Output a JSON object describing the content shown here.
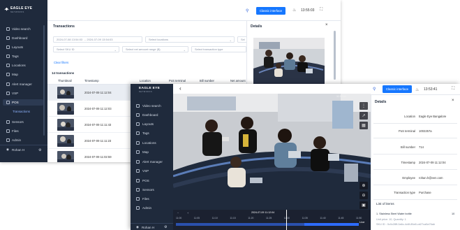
{
  "colors": {
    "sidebar_bg": "#1f2a3c",
    "accent": "#1677ff",
    "link": "#1677ff",
    "selected_row": "#e9edf3"
  },
  "brand": {
    "name": "EAGLE EYE",
    "tagline": "NETWORKS"
  },
  "sidebar": {
    "items": [
      {
        "label": "Video search",
        "icon": "video-search-icon"
      },
      {
        "label": "Dashboard",
        "icon": "dashboard-icon"
      },
      {
        "label": "Layouts",
        "icon": "layouts-icon"
      },
      {
        "label": "Tags",
        "icon": "tag-icon"
      },
      {
        "label": "Locations",
        "icon": "location-icon"
      },
      {
        "label": "Map",
        "icon": "map-icon"
      },
      {
        "label": "Alert manager",
        "icon": "alert-icon"
      },
      {
        "label": "VSP",
        "icon": "vsp-icon"
      },
      {
        "label": "POS",
        "icon": "pos-icon"
      },
      {
        "label": "Sensors",
        "icon": "sensor-icon"
      },
      {
        "label": "Files",
        "icon": "files-icon"
      },
      {
        "label": "Admin",
        "icon": "admin-icon"
      }
    ],
    "pos_sub_item": "Transactions",
    "user_name": "Rohan H"
  },
  "topbar": {
    "classic_button": "Classic interface",
    "back_time": "13:55:03",
    "front_time": "13:53:41"
  },
  "transactions": {
    "title": "Transactions",
    "filters": {
      "date_range": "2024-07-08 13:54:03 → 2024-07-09 13:54:03",
      "locations": "Select locations",
      "third": "Sel",
      "sku": "Select SKU ID",
      "net_amount": "Select net amount range ($)",
      "type": "Select transaction type"
    },
    "clear_filters": "Clear filters",
    "count": "14 transactions",
    "columns": [
      "Thumbnail",
      "Timestamp",
      "Location",
      "PoS terminal",
      "Bill number",
      "Net amount"
    ],
    "rows": [
      {
        "timestamp": "2024-07-09 11:12:04"
      },
      {
        "timestamp": "2024-07-09 11:12:03"
      },
      {
        "timestamp": "2024-07-09 11:11:43"
      },
      {
        "timestamp": "2024-07-09 11:11:23"
      },
      {
        "timestamp": "2024-07-09 11:02:59"
      }
    ]
  },
  "details_back": {
    "title": "Details"
  },
  "video": {
    "overlay_timestamp": "11:12:04",
    "timeline": {
      "date": "2024-07-09",
      "time": "11:12:04",
      "labels": [
        "11:00",
        "11:05",
        "11:10",
        "11:15",
        "11:20",
        "11:25",
        "11:30",
        "11:35",
        "11:40",
        "11:45",
        "11:50"
      ],
      "live": "Live"
    }
  },
  "details": {
    "title": "Details",
    "fields": [
      {
        "key": "Location",
        "value": "Eagle Eye Bangalore"
      },
      {
        "key": "PoS terminal",
        "value": "1002257a"
      },
      {
        "key": "Bill number",
        "value": "714"
      },
      {
        "key": "Timestamp",
        "value": "2024-07-09 11:12:04"
      },
      {
        "key": "Employee",
        "value": "rohan.h@een.com"
      },
      {
        "key": "Transaction type",
        "value": "Purchase"
      }
    ],
    "list_title": "List of items",
    "item_name": "1. Stainless Steel Water bottle",
    "item_qty": "10",
    "item_price": "Unit price: 10, Quantity: 1",
    "item_sku": "SKU ID : 0c0c28ff-0a6c-4c6f-85a5-cd27ca5a76ab"
  }
}
